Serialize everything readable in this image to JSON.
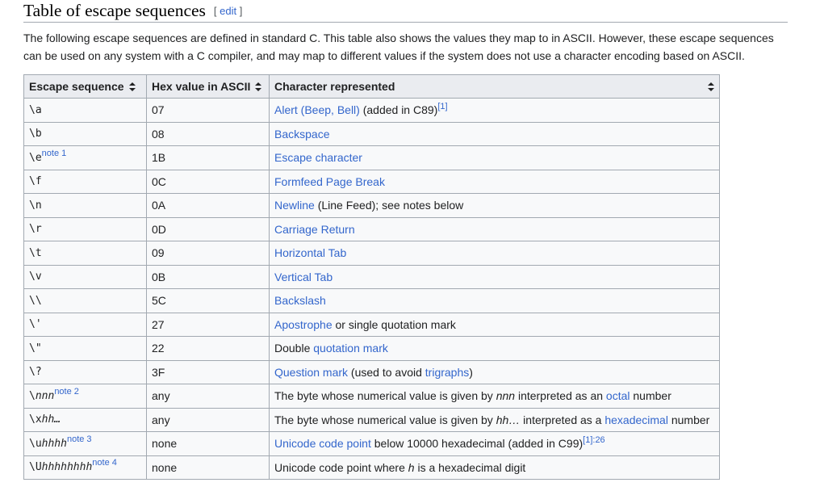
{
  "heading": {
    "title": "Table of escape sequences",
    "edit_open": "[",
    "edit_label": "edit",
    "edit_close": "]"
  },
  "intro": "The following escape sequences are defined in standard C. This table also shows the values they map to in ASCII. However, these escape sequences can be used on any system with a C compiler, and may map to different values if the system does not use a character encoding based on ASCII.",
  "table": {
    "headers": [
      "Escape sequence",
      "Hex value in ASCII",
      "Character represented"
    ],
    "rows": [
      {
        "esc": "\\a",
        "hex": "07",
        "link": "Alert (Beep, Bell)",
        "after": " (added in C89)",
        "ref": "[1]"
      },
      {
        "esc": "\\b",
        "hex": "08",
        "link": "Backspace"
      },
      {
        "esc": "\\e",
        "esc_note": "note 1",
        "hex": "1B",
        "link": "Escape character"
      },
      {
        "esc": "\\f",
        "hex": "0C",
        "link": "Formfeed Page Break"
      },
      {
        "esc": "\\n",
        "hex": "0A",
        "link": "Newline",
        "after": " (Line Feed); see notes below"
      },
      {
        "esc": "\\r",
        "hex": "0D",
        "link": "Carriage Return"
      },
      {
        "esc": "\\t",
        "hex": "09",
        "link": "Horizontal Tab"
      },
      {
        "esc": "\\v",
        "hex": "0B",
        "link": "Vertical Tab"
      },
      {
        "esc": "\\\\",
        "hex": "5C",
        "link": "Backslash"
      },
      {
        "esc": "\\'",
        "hex": "27",
        "link": "Apostrophe",
        "after": " or single quotation mark"
      },
      {
        "esc": "\\\"",
        "hex": "22",
        "before": "Double ",
        "link": "quotation mark"
      },
      {
        "esc": "\\?",
        "hex": "3F",
        "link": "Question mark",
        "after": " (used to avoid ",
        "link2": "trigraphs",
        "after2": ")"
      },
      {
        "esc": "\\",
        "esc_italic": "nnn",
        "esc_note": "note 2",
        "hex": "any",
        "before": "The byte whose numerical value is given by ",
        "italic": "nnn",
        "mid": " interpreted as an ",
        "link": "octal",
        "after": " number"
      },
      {
        "esc": "\\x",
        "esc_italic": "hh…",
        "hex": "any",
        "before": "The byte whose numerical value is given by ",
        "italic": "hh…",
        "mid": " interpreted as a ",
        "link": "hexadecimal",
        "after": " number"
      },
      {
        "esc": "\\u",
        "esc_italic": "hhhh",
        "esc_note": "note 3",
        "hex": "none",
        "link": "Unicode code point",
        "after": " below 10000 hexadecimal (added in C99)",
        "ref": "[1]:26"
      },
      {
        "esc": "\\U",
        "esc_italic": "hhhhhhhh",
        "esc_note": "note 4",
        "hex": "none",
        "before": "Unicode code point where ",
        "italic": "h",
        "mid": " is a hexadecimal digit"
      }
    ]
  }
}
